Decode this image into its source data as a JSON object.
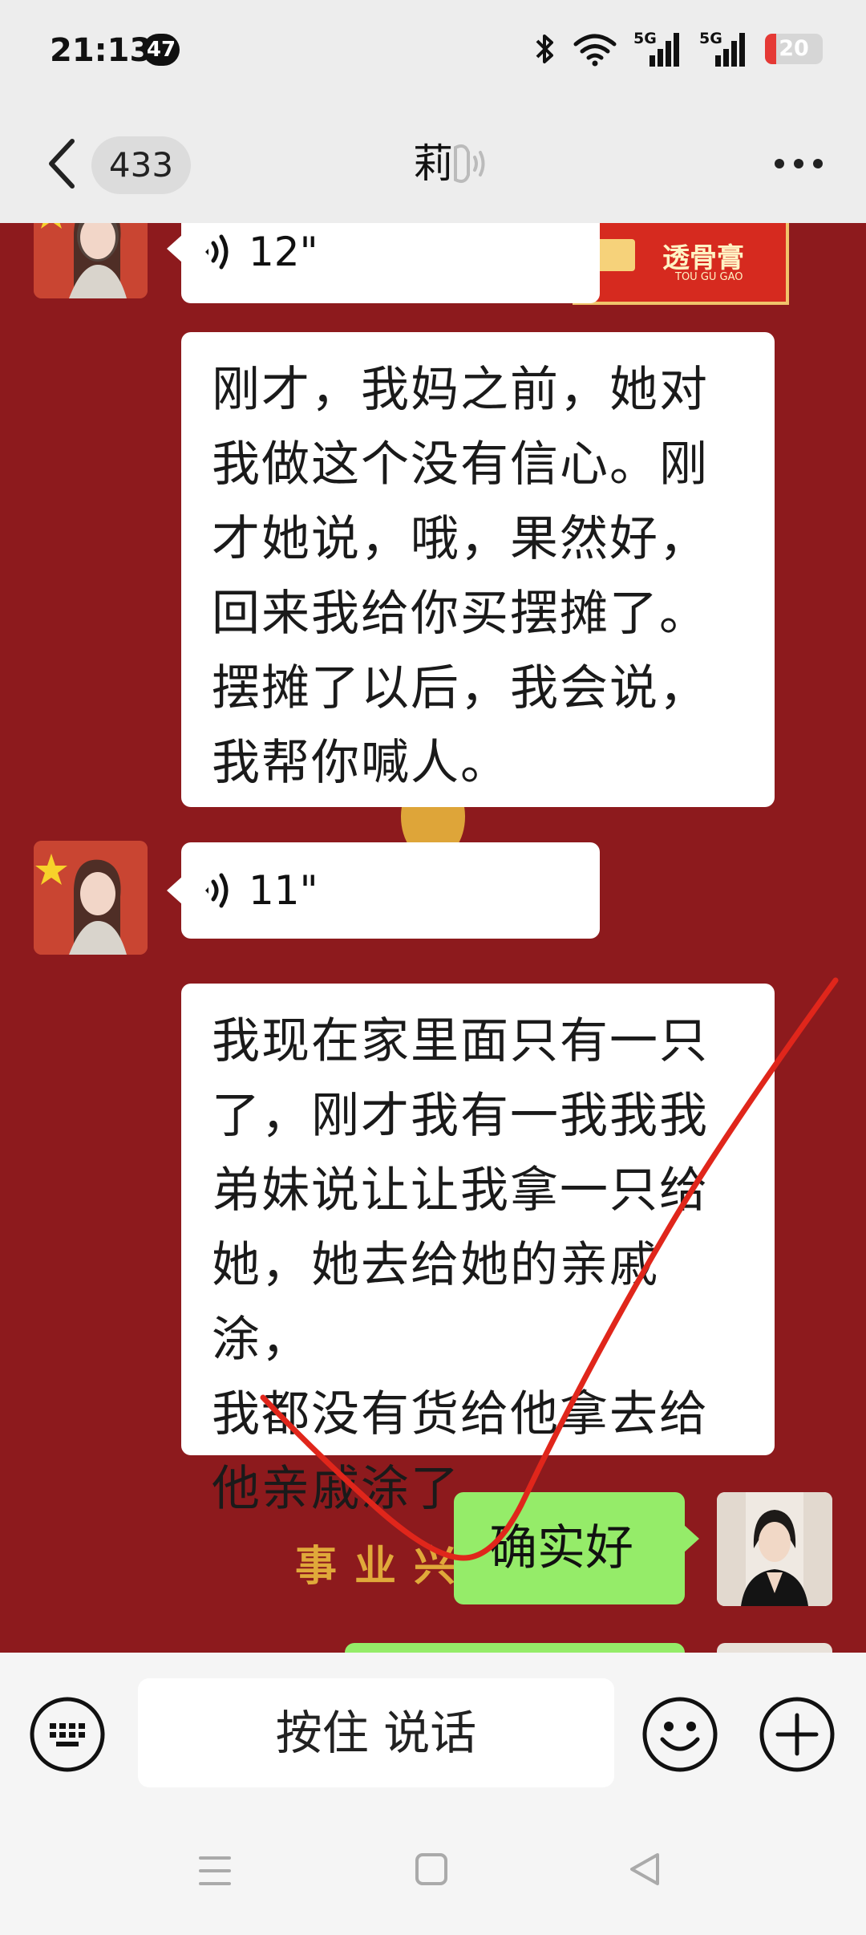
{
  "status": {
    "time": "21:13",
    "notification_count": "47",
    "battery_level": "20",
    "battery_fraction": 0.2,
    "network_labels": [
      "5G",
      "5G"
    ]
  },
  "header": {
    "unread_count": "433",
    "title": "莉"
  },
  "messages": [
    {
      "from": "contact",
      "type": "voice",
      "duration": "12\""
    },
    {
      "from": "contact",
      "type": "text",
      "lines": [
        "刚才，我妈之前，她对",
        "我做这个没有信心。刚",
        "才她说，哦，果然好，",
        "回来我给你买摆摊了。",
        "摆摊了以后，我会说，",
        "我帮你喊人。"
      ]
    },
    {
      "from": "contact",
      "type": "voice",
      "duration": "11\""
    },
    {
      "from": "contact",
      "type": "text",
      "lines": [
        "我现在家里面只有一只",
        "了，刚才我有一我我我",
        "弟妹说让让我拿一只给",
        "她，她去给她的亲戚涂，",
        "我都没有货给他拿去给",
        "他亲戚涂了。"
      ]
    },
    {
      "from": "self",
      "type": "text",
      "text": "确实好"
    }
  ],
  "product_ad": {
    "name": "透骨膏",
    "romanization": "TOU GU GAO"
  },
  "background_text": "事业兴",
  "input": {
    "hold_to_talk": "按住 说话"
  },
  "colors": {
    "chat_background": "#8d1a1d",
    "self_bubble": "#95ec69",
    "annotation_stroke": "#e0261b"
  }
}
